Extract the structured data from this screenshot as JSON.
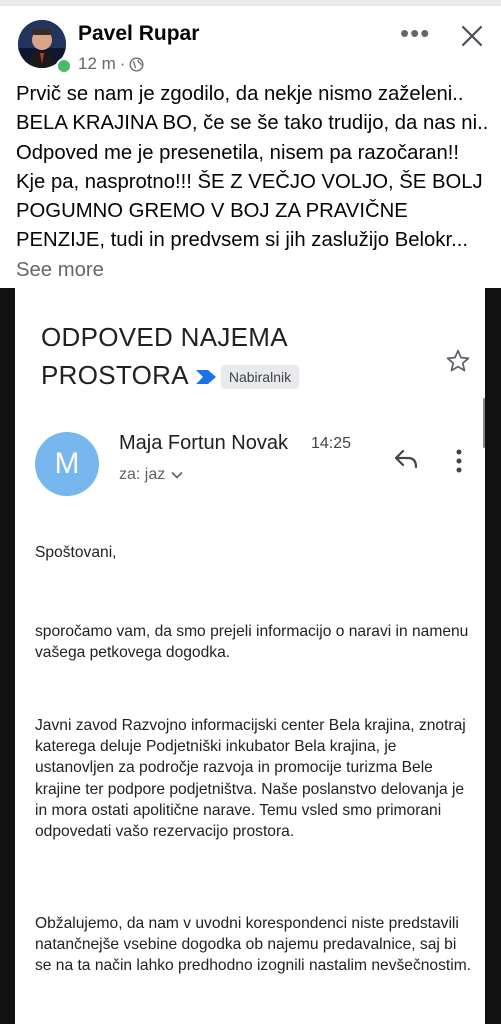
{
  "post": {
    "author": "Pavel Rupar",
    "time": "12 m",
    "separator": "·",
    "more_label": "•••",
    "text": "Prvič se nam je zgodilo, da nekje nismo zaželeni.. BELA KRAJINA BO, če se še tako trudijo, da nas ni.. Odpoved me je presenetila, nisem pa razočaran!! Kje pa, nasprotno!!! ŠE Z VEČJO VOLJO, ŠE BOLJ POGUMNO GREMO V BOJ ZA PRAVIČNE PENZIJE, tudi in predvsem si jih zaslužijo Belokr...",
    "see_more": "See more",
    "online_color": "#45bd62"
  },
  "email": {
    "subject": "ODPOVED NAJEMA PROSTORA",
    "label": "Nabiralnik",
    "sender_initial": "M",
    "sender_name": "Maja Fortun Novak",
    "time": "14:25",
    "recipient": "za: jaz",
    "greeting": "Spoštovani,",
    "paragraphs": [
      "sporočamo vam, da smo prejeli informacijo o naravi in namenu vašega petkovega dogodka.",
      "Javni zavod Razvojno informacijski center Bela krajina, znotraj katerega deluje Podjetniški inkubator Bela krajina, je ustanovljen za področje razvoja in promocije turizma Bele krajine ter podpore podjetništva. Naše poslanstvo delovanja je in mora ostati apolitične narave. Temu vsled smo primorani odpovedati vašo rezervacijo prostora.",
      "Obžalujemo, da nam v uvodni korespondenci niste predstavili natančnejše vsebine dogodka ob najemu predavalnice, saj bi se na ta način lahko predhodno izognili nastalim nevšečnostim."
    ],
    "avatar_color": "#77b7ee",
    "important_color": "#1a73e8"
  }
}
